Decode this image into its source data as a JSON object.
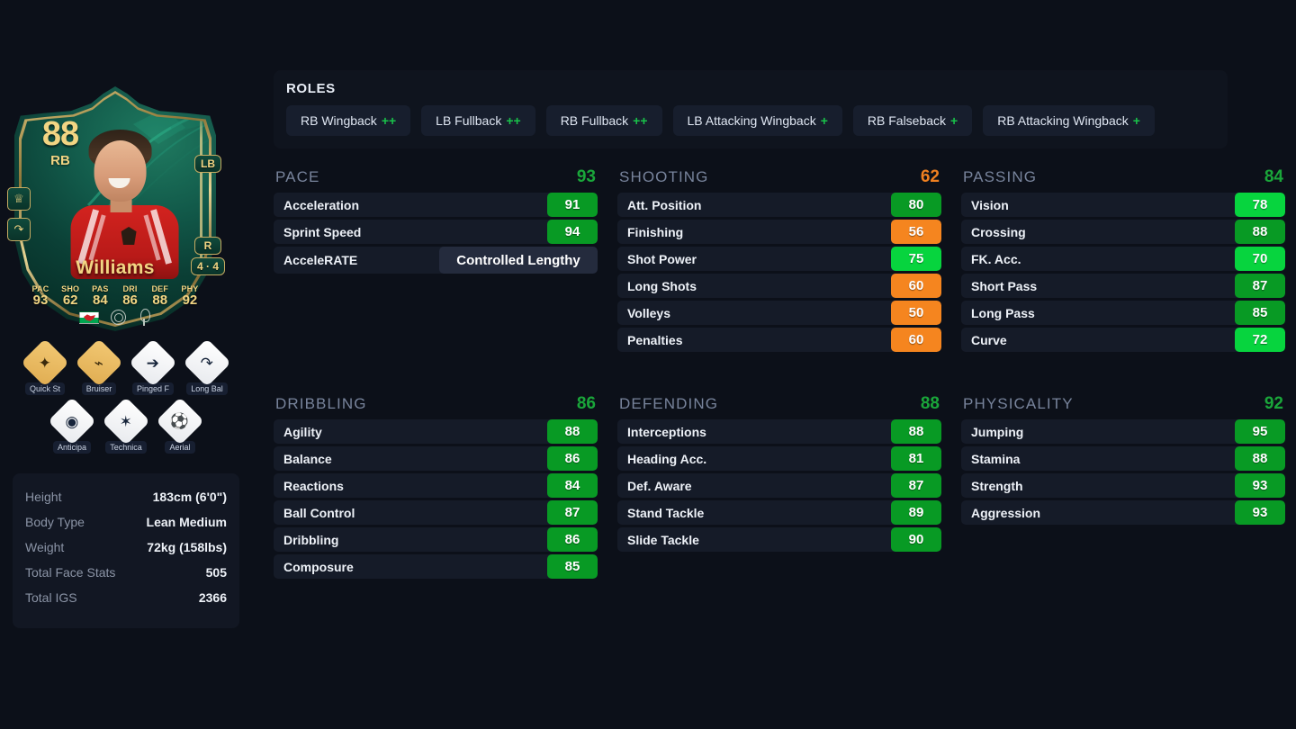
{
  "card": {
    "rating": "88",
    "position": "RB",
    "name": "Williams",
    "alt_position": "LB",
    "foot": "R",
    "skills_weakfoot": "4 · 4",
    "face_stats": [
      {
        "label": "PAC",
        "value": "93"
      },
      {
        "label": "SHO",
        "value": "62"
      },
      {
        "label": "PAS",
        "value": "84"
      },
      {
        "label": "DRI",
        "value": "86"
      },
      {
        "label": "DEF",
        "value": "88"
      },
      {
        "label": "PHY",
        "value": "92"
      }
    ],
    "nation_icon": "wales-flag-icon",
    "league_icon": "premier-league-icon",
    "club_icon": "nottingham-forest-crest-icon"
  },
  "playstyles": {
    "row1": [
      {
        "label": "Quick St",
        "tier": "gold",
        "icon": "quick-step-icon",
        "glyph": "✦"
      },
      {
        "label": "Bruiser",
        "tier": "gold",
        "icon": "bruiser-icon",
        "glyph": "💪"
      },
      {
        "label": "Pinged F",
        "tier": "silver",
        "icon": "pinged-pass-icon",
        "glyph": "➔"
      },
      {
        "label": "Long Bal",
        "tier": "silver",
        "icon": "long-ball-pass-icon",
        "glyph": "↷"
      }
    ],
    "row2": [
      {
        "label": "Anticipa",
        "tier": "silver",
        "icon": "anticipate-icon",
        "glyph": "◉"
      },
      {
        "label": "Technica",
        "tier": "silver",
        "icon": "technical-icon",
        "glyph": "✶"
      },
      {
        "label": "Aerial",
        "tier": "silver",
        "icon": "aerial-icon",
        "glyph": "⚽"
      }
    ]
  },
  "bio": {
    "rows": [
      {
        "key": "Height",
        "value": "183cm (6'0\")"
      },
      {
        "key": "Body Type",
        "value": "Lean Medium"
      },
      {
        "key": "Weight",
        "value": "72kg (158lbs)"
      },
      {
        "key": "Total Face Stats",
        "value": "505"
      },
      {
        "key": "Total IGS",
        "value": "2366"
      }
    ]
  },
  "roles": {
    "title": "ROLES",
    "items": [
      {
        "name": "RB Wingback",
        "plus": "++"
      },
      {
        "name": "LB Fullback",
        "plus": "++"
      },
      {
        "name": "RB Fullback",
        "plus": "++"
      },
      {
        "name": "LB Attacking Wingback",
        "plus": "+"
      },
      {
        "name": "RB Falseback",
        "plus": "+"
      },
      {
        "name": "RB Attacking Wingback",
        "plus": "+"
      }
    ]
  },
  "colors": {
    "green_dark": "#089a24",
    "green_bright": "#07d43e",
    "orange": "#f5851f",
    "page_bg": "#0c1019",
    "row_bg": "#151b28"
  },
  "sections": [
    {
      "name": "PACE",
      "value": "93",
      "value_tone": "green",
      "stats": [
        {
          "label": "Acceleration",
          "value": "91",
          "tone": "v-green-d"
        },
        {
          "label": "Sprint Speed",
          "value": "94",
          "tone": "v-green-d"
        }
      ],
      "accelerate": {
        "label": "AcceleRATE",
        "value": "Controlled Lengthy"
      }
    },
    {
      "name": "SHOOTING",
      "value": "62",
      "value_tone": "orange",
      "stats": [
        {
          "label": "Att. Position",
          "value": "80",
          "tone": "v-green-d"
        },
        {
          "label": "Finishing",
          "value": "56",
          "tone": "v-orange"
        },
        {
          "label": "Shot Power",
          "value": "75",
          "tone": "v-green-b"
        },
        {
          "label": "Long Shots",
          "value": "60",
          "tone": "v-orange"
        },
        {
          "label": "Volleys",
          "value": "50",
          "tone": "v-orange"
        },
        {
          "label": "Penalties",
          "value": "60",
          "tone": "v-orange"
        }
      ]
    },
    {
      "name": "PASSING",
      "value": "84",
      "value_tone": "green",
      "stats": [
        {
          "label": "Vision",
          "value": "78",
          "tone": "v-green-b"
        },
        {
          "label": "Crossing",
          "value": "88",
          "tone": "v-green-d"
        },
        {
          "label": "FK. Acc.",
          "value": "70",
          "tone": "v-green-b"
        },
        {
          "label": "Short Pass",
          "value": "87",
          "tone": "v-green-d"
        },
        {
          "label": "Long Pass",
          "value": "85",
          "tone": "v-green-d"
        },
        {
          "label": "Curve",
          "value": "72",
          "tone": "v-green-b"
        }
      ]
    },
    {
      "name": "DRIBBLING",
      "value": "86",
      "value_tone": "green",
      "stats": [
        {
          "label": "Agility",
          "value": "88",
          "tone": "v-green-d"
        },
        {
          "label": "Balance",
          "value": "86",
          "tone": "v-green-d"
        },
        {
          "label": "Reactions",
          "value": "84",
          "tone": "v-green-d"
        },
        {
          "label": "Ball Control",
          "value": "87",
          "tone": "v-green-d"
        },
        {
          "label": "Dribbling",
          "value": "86",
          "tone": "v-green-d"
        },
        {
          "label": "Composure",
          "value": "85",
          "tone": "v-green-d"
        }
      ]
    },
    {
      "name": "DEFENDING",
      "value": "88",
      "value_tone": "green",
      "stats": [
        {
          "label": "Interceptions",
          "value": "88",
          "tone": "v-green-d"
        },
        {
          "label": "Heading Acc.",
          "value": "81",
          "tone": "v-green-d"
        },
        {
          "label": "Def. Aware",
          "value": "87",
          "tone": "v-green-d"
        },
        {
          "label": "Stand Tackle",
          "value": "89",
          "tone": "v-green-d"
        },
        {
          "label": "Slide Tackle",
          "value": "90",
          "tone": "v-green-d"
        }
      ]
    },
    {
      "name": "PHYSICALITY",
      "value": "92",
      "value_tone": "green",
      "stats": [
        {
          "label": "Jumping",
          "value": "95",
          "tone": "v-green-d"
        },
        {
          "label": "Stamina",
          "value": "88",
          "tone": "v-green-d"
        },
        {
          "label": "Strength",
          "value": "93",
          "tone": "v-green-d"
        },
        {
          "label": "Aggression",
          "value": "93",
          "tone": "v-green-d"
        }
      ]
    }
  ]
}
